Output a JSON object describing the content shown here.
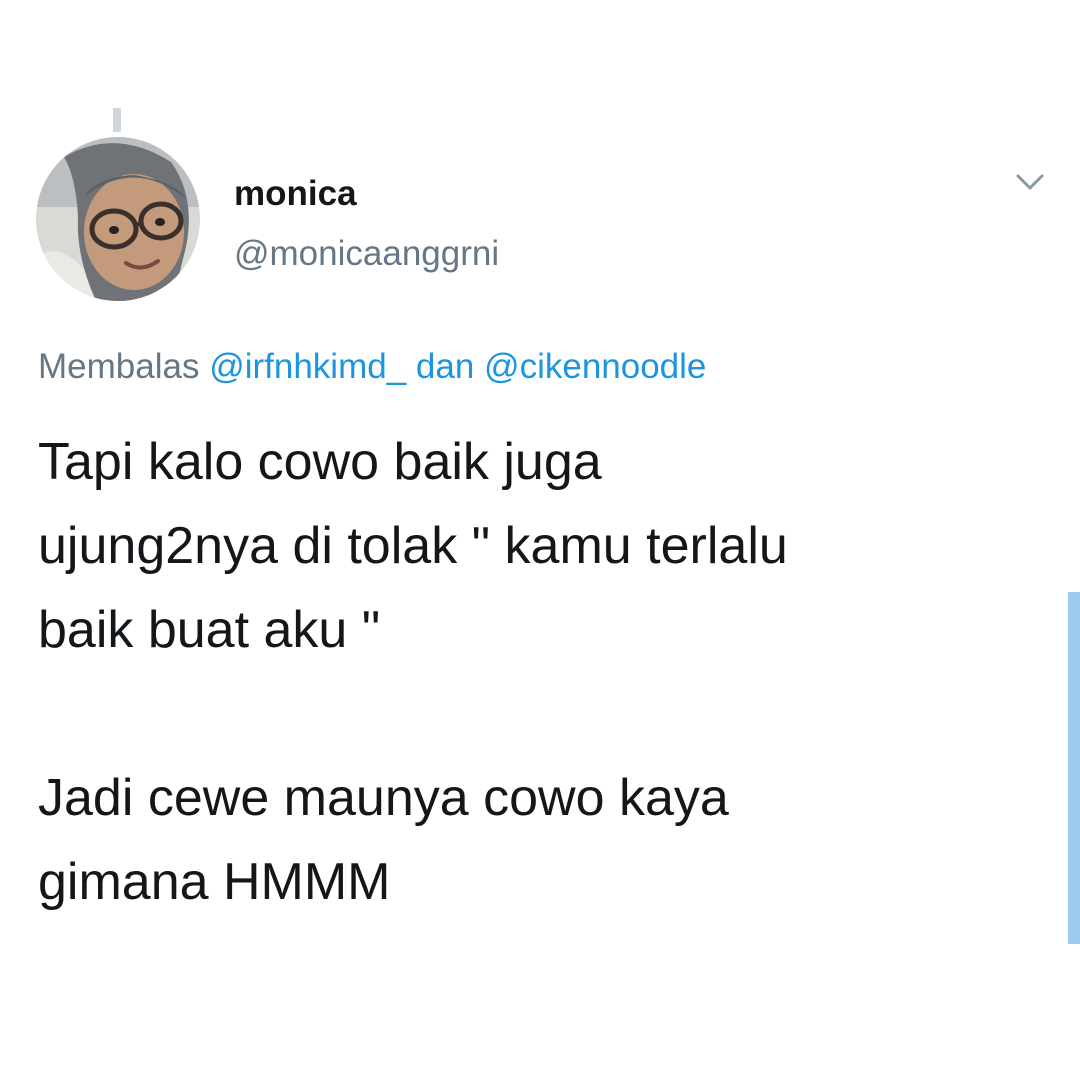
{
  "tweet": {
    "author": {
      "display_name": "monica",
      "handle": "@monicaanggrni",
      "avatar_icon": "profile-photo"
    },
    "reply_to": {
      "prefix": "Membalas",
      "mention_1": "@irfnhkimd_",
      "conjunction": "dan",
      "mention_2": "@cikennoodle"
    },
    "text": {
      "paragraph_1": "Tapi kalo cowo baik juga\nujung2nya di tolak \" kamu terlalu\nbaik buat aku \"",
      "paragraph_2": "Jadi cewe maunya cowo kaya\ngimana HMMM"
    },
    "menu_icon": "chevron-down-icon"
  },
  "colors": {
    "text_primary": "#14171a",
    "text_secondary": "#657786",
    "link": "#1b95e0",
    "scrollbar": "#9ccbee",
    "thread_line": "#cfd6dc"
  }
}
